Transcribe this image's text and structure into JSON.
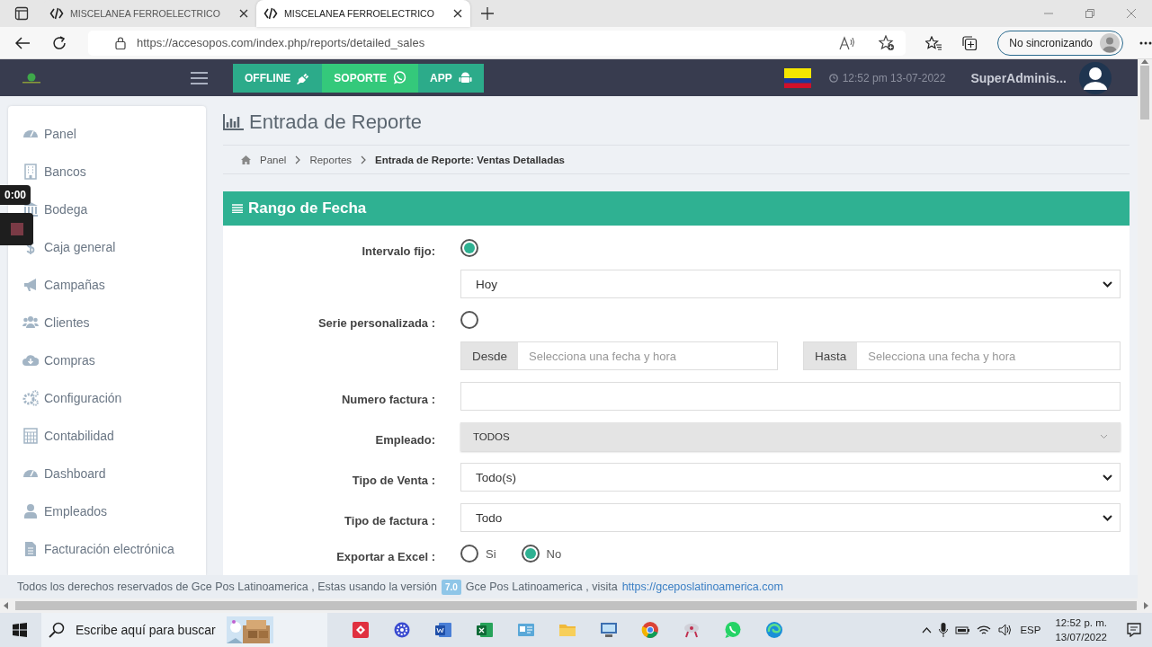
{
  "browser": {
    "tabs": [
      {
        "title": "MISCELANEA FERROELECTRICO",
        "selected": false
      },
      {
        "title": "MISCELANEA FERROELECTRICO",
        "selected": true
      }
    ],
    "url": "https://accesopos.com/index.php/reports/detailed_sales",
    "profile_label": "No sincronizando"
  },
  "header": {
    "buttons": [
      {
        "label": "OFFLINE",
        "kind": "plug"
      },
      {
        "label": "SOPORTE",
        "kind": "chat"
      },
      {
        "label": "APP",
        "kind": "android"
      }
    ],
    "clock": "12:52 pm 13-07-2022",
    "user": "SuperAdminis..."
  },
  "sidebar": {
    "items": [
      {
        "label": "Panel",
        "kind": "gauge"
      },
      {
        "label": "Bancos",
        "kind": "building"
      },
      {
        "label": "Bodega",
        "kind": "columns"
      },
      {
        "label": "Caja general",
        "kind": "dollar"
      },
      {
        "label": "Campañas",
        "kind": "bullhorn"
      },
      {
        "label": "Clientes",
        "kind": "users"
      },
      {
        "label": "Compras",
        "kind": "cloud"
      },
      {
        "label": "Configuración",
        "kind": "gears"
      },
      {
        "label": "Contabilidad",
        "kind": "calculator"
      },
      {
        "label": "Dashboard",
        "kind": "gauge"
      },
      {
        "label": "Empleados",
        "kind": "user"
      },
      {
        "label": "Facturación electrónica",
        "kind": "file"
      }
    ]
  },
  "page": {
    "title": "Entrada de Reporte",
    "breadcrumb": [
      {
        "label": "Panel",
        "current": false
      },
      {
        "label": "Reportes",
        "current": false
      },
      {
        "label": "Entrada de Reporte: Ventas Detalladas",
        "current": true
      }
    ],
    "panel_title": "Rango de Fecha",
    "form": [
      {
        "kind": "radio",
        "label": "Intervalo fijo:",
        "selected": true
      },
      {
        "kind": "select",
        "value": "Hoy"
      },
      {
        "kind": "radio",
        "label": "Serie personalizada :",
        "selected": false
      },
      {
        "kind": "daterange",
        "from": {
          "addon": "Desde",
          "placeholder": "Selecciona una fecha y hora"
        },
        "to": {
          "addon": "Hasta",
          "placeholder": "Selecciona una fecha y hora"
        }
      },
      {
        "kind": "input",
        "label": "Numero factura :"
      },
      {
        "kind": "select2",
        "label": "Empleado:",
        "value": "TODOS"
      },
      {
        "kind": "select",
        "label": "Tipo de Venta :",
        "value": "Todo(s)"
      },
      {
        "kind": "select",
        "label": "Tipo de factura :",
        "value": "Todo"
      },
      {
        "kind": "radiogroup",
        "label": "Exportar a Excel :",
        "options": [
          {
            "label": "Si",
            "selected": false
          },
          {
            "label": "No",
            "selected": true
          }
        ]
      }
    ]
  },
  "footer": {
    "text": "Todos los derechos reservados de Gce Pos Latinoamerica , Estas usando la versión",
    "version": "7.0",
    "text_after": "Gce Pos Latinoamerica , visita",
    "link": "https://gceposlatinoamerica.com"
  },
  "recorder": {
    "timer": "0:00"
  },
  "taskbar": {
    "search_placeholder": "Escribe aquí para buscar",
    "apps": [
      {
        "kind": "diamond"
      },
      {
        "kind": "flower"
      },
      {
        "kind": "document"
      },
      {
        "kind": "spreadsheet"
      },
      {
        "kind": "card"
      },
      {
        "kind": "folder"
      },
      {
        "kind": "monitor"
      },
      {
        "kind": "browser"
      },
      {
        "kind": "satellite"
      },
      {
        "kind": "chat"
      },
      {
        "kind": "wave"
      }
    ],
    "language": "ESP",
    "time": "12:52 p. m.",
    "date": "13/07/2022"
  }
}
